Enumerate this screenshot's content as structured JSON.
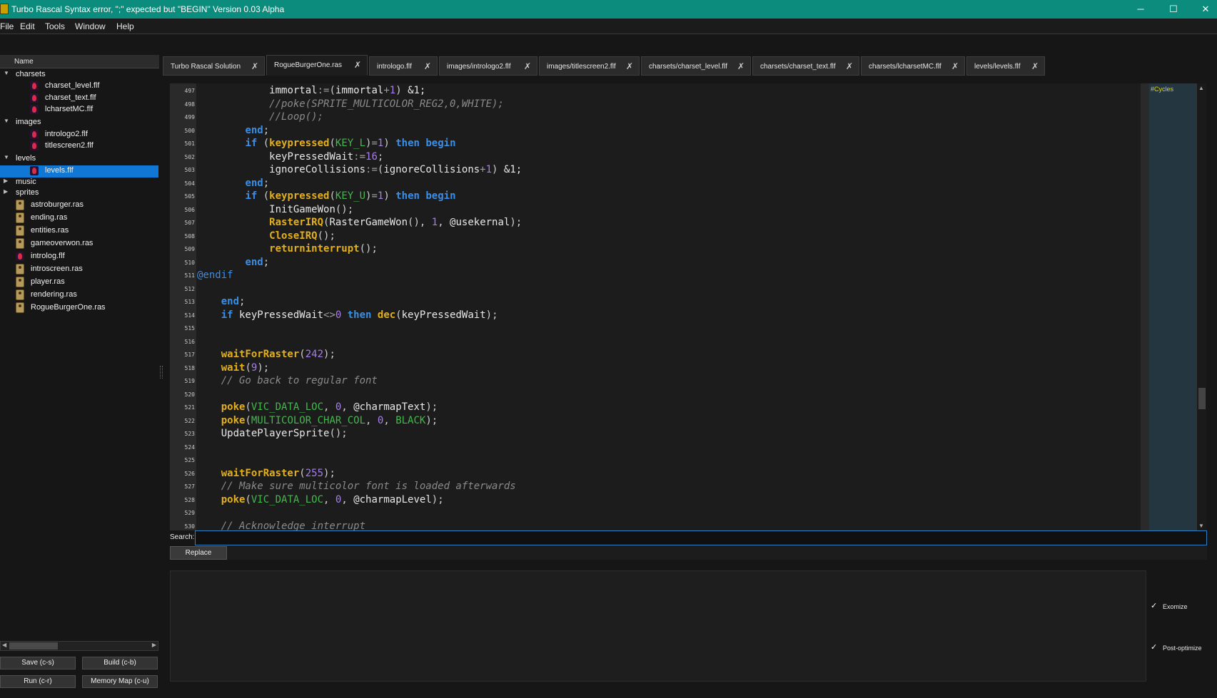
{
  "window": {
    "title": "Turbo Rascal Syntax error, \";\" expected but \"BEGIN\" Version 0.03 Alpha",
    "minimize": "─",
    "maximize": "☐",
    "close": "✕"
  },
  "menu": [
    "File",
    "Edit",
    "Tools",
    "Window",
    "Help"
  ],
  "tree": {
    "header": "Name",
    "nodes": [
      {
        "label": "charsets",
        "kind": "folder",
        "expanded": true
      },
      {
        "label": "charset_level.flf",
        "kind": "flf"
      },
      {
        "label": "charset_text.flf",
        "kind": "flf"
      },
      {
        "label": "lcharsetMC.flf",
        "kind": "flf"
      },
      {
        "label": "images",
        "kind": "folder",
        "expanded": true
      },
      {
        "label": "intrologo2.flf",
        "kind": "flf"
      },
      {
        "label": "titlescreen2.flf",
        "kind": "flf"
      },
      {
        "label": "levels",
        "kind": "folder",
        "expanded": true
      },
      {
        "label": "levels.flf",
        "kind": "flf",
        "selected": true
      },
      {
        "label": "music",
        "kind": "folder",
        "expanded": false
      },
      {
        "label": "sprites",
        "kind": "folder",
        "expanded": false
      },
      {
        "label": "astroburger.ras",
        "kind": "ras"
      },
      {
        "label": "ending.ras",
        "kind": "ras"
      },
      {
        "label": "entities.ras",
        "kind": "ras"
      },
      {
        "label": "gameoverwon.ras",
        "kind": "ras"
      },
      {
        "label": "introlog.flf",
        "kind": "flf"
      },
      {
        "label": "introscreen.ras",
        "kind": "ras"
      },
      {
        "label": "player.ras",
        "kind": "ras"
      },
      {
        "label": "rendering.ras",
        "kind": "ras"
      },
      {
        "label": "RogueBurgerOne.ras",
        "kind": "ras"
      }
    ]
  },
  "buttons": {
    "save": "Save (c-s)",
    "build": "Build (c-b)",
    "run": "Run (c-r)",
    "memory_map": "Memory Map (c-u)",
    "replace": "Replace"
  },
  "tabs": [
    {
      "label": "Turbo Rascal Solution"
    },
    {
      "label": "RogueBurgerOne.ras",
      "active": true
    },
    {
      "label": "intrologo.flf"
    },
    {
      "label": "images/intrologo2.flf"
    },
    {
      "label": "images/titlescreen2.flf"
    },
    {
      "label": "charsets/charset_level.flf"
    },
    {
      "label": "charsets/charset_text.flf"
    },
    {
      "label": "charsets/lcharsetMC.flf"
    },
    {
      "label": "levels/levels.flf"
    }
  ],
  "tab_close_glyph": "✗",
  "code": {
    "first_line": 497,
    "lines": [
      [
        [
          "",
          "            "
        ],
        [
          "var",
          "immortal"
        ],
        [
          "op",
          ":="
        ],
        [
          "pun",
          "("
        ],
        [
          "var",
          "immortal"
        ],
        [
          "op",
          "+"
        ],
        [
          "num",
          "1"
        ],
        [
          "pun",
          ")"
        ],
        [
          "var",
          " &1;"
        ]
      ],
      [
        [
          "cm",
          "            //poke(SPRITE_MULTICOLOR_REG2,0,WHITE);"
        ]
      ],
      [
        [
          "cm",
          "            //Loop();"
        ]
      ],
      [
        [
          "",
          "        "
        ],
        [
          "kw",
          "end"
        ],
        [
          "pun",
          ";"
        ]
      ],
      [
        [
          "",
          "        "
        ],
        [
          "kw",
          "if"
        ],
        [
          "pun",
          " ("
        ],
        [
          "fn",
          "keypressed"
        ],
        [
          "pun",
          "("
        ],
        [
          "con",
          "KEY_L"
        ],
        [
          "pun",
          ")"
        ],
        [
          "op",
          "="
        ],
        [
          "num",
          "1"
        ],
        [
          "pun",
          ") "
        ],
        [
          "kw",
          "then begin"
        ]
      ],
      [
        [
          "",
          "            "
        ],
        [
          "var",
          "keyPressedWait"
        ],
        [
          "op",
          ":="
        ],
        [
          "num",
          "16"
        ],
        [
          "pun",
          ";"
        ]
      ],
      [
        [
          "",
          "            "
        ],
        [
          "var",
          "ignoreCollisions"
        ],
        [
          "op",
          ":="
        ],
        [
          "pun",
          "("
        ],
        [
          "var",
          "ignoreCollisions"
        ],
        [
          "op",
          "+"
        ],
        [
          "num",
          "1"
        ],
        [
          "pun",
          ")"
        ],
        [
          "var",
          " &1;"
        ]
      ],
      [
        [
          "",
          "        "
        ],
        [
          "kw",
          "end"
        ],
        [
          "pun",
          ";"
        ]
      ],
      [
        [
          "",
          "        "
        ],
        [
          "kw",
          "if"
        ],
        [
          "pun",
          " ("
        ],
        [
          "fn",
          "keypressed"
        ],
        [
          "pun",
          "("
        ],
        [
          "con",
          "KEY_U"
        ],
        [
          "pun",
          ")"
        ],
        [
          "op",
          "="
        ],
        [
          "num",
          "1"
        ],
        [
          "pun",
          ") "
        ],
        [
          "kw",
          "then begin"
        ]
      ],
      [
        [
          "",
          "            "
        ],
        [
          "var",
          "InitGameWon"
        ],
        [
          "pun",
          "();"
        ]
      ],
      [
        [
          "",
          "            "
        ],
        [
          "fn",
          "RasterIRQ"
        ],
        [
          "pun",
          "("
        ],
        [
          "var",
          "RasterGameWon"
        ],
        [
          "pun",
          "(), "
        ],
        [
          "num",
          "1"
        ],
        [
          "pun",
          ", "
        ],
        [
          "var",
          "@usekernal"
        ],
        [
          "pun",
          ");"
        ]
      ],
      [
        [
          "",
          "            "
        ],
        [
          "fn",
          "CloseIRQ"
        ],
        [
          "pun",
          "();"
        ]
      ],
      [
        [
          "",
          "            "
        ],
        [
          "fn",
          "returninterrupt"
        ],
        [
          "pun",
          "();"
        ]
      ],
      [
        [
          "",
          "        "
        ],
        [
          "kw",
          "end"
        ],
        [
          "pun",
          ";"
        ]
      ],
      [
        [
          "pre",
          "@endif"
        ]
      ],
      [],
      [
        [
          "",
          "    "
        ],
        [
          "kw",
          "end"
        ],
        [
          "pun",
          ";"
        ]
      ],
      [
        [
          "",
          "    "
        ],
        [
          "kw",
          "if"
        ],
        [
          "var",
          " keyPressedWait"
        ],
        [
          "op",
          "<>"
        ],
        [
          "num",
          "0"
        ],
        [
          "kw",
          " then "
        ],
        [
          "fn",
          "dec"
        ],
        [
          "pun",
          "("
        ],
        [
          "var",
          "keyPressedWait"
        ],
        [
          "pun",
          ");"
        ]
      ],
      [],
      [],
      [
        [
          "",
          "    "
        ],
        [
          "fn",
          "waitForRaster"
        ],
        [
          "pun",
          "("
        ],
        [
          "num",
          "242"
        ],
        [
          "pun",
          ");"
        ]
      ],
      [
        [
          "",
          "    "
        ],
        [
          "fn",
          "wait"
        ],
        [
          "pun",
          "("
        ],
        [
          "num",
          "9"
        ],
        [
          "pun",
          ");"
        ]
      ],
      [
        [
          "cm",
          "    // Go back to regular font"
        ]
      ],
      [],
      [
        [
          "",
          "    "
        ],
        [
          "fn",
          "poke"
        ],
        [
          "pun",
          "("
        ],
        [
          "con",
          "VIC_DATA_LOC"
        ],
        [
          "pun",
          ", "
        ],
        [
          "num",
          "0"
        ],
        [
          "pun",
          ", "
        ],
        [
          "var",
          "@charmapText"
        ],
        [
          "pun",
          ");"
        ]
      ],
      [
        [
          "",
          "    "
        ],
        [
          "fn",
          "poke"
        ],
        [
          "pun",
          "("
        ],
        [
          "con",
          "MULTICOLOR_CHAR_COL"
        ],
        [
          "pun",
          ", "
        ],
        [
          "num",
          "0"
        ],
        [
          "pun",
          ", "
        ],
        [
          "con",
          "BLACK"
        ],
        [
          "pun",
          ");"
        ]
      ],
      [
        [
          "",
          "    "
        ],
        [
          "var",
          "UpdatePlayerSprite"
        ],
        [
          "pun",
          "();"
        ]
      ],
      [],
      [],
      [
        [
          "",
          "    "
        ],
        [
          "fn",
          "waitForRaster"
        ],
        [
          "pun",
          "("
        ],
        [
          "num",
          "255"
        ],
        [
          "pun",
          ");"
        ]
      ],
      [
        [
          "cm",
          "    // Make sure multicolor font is loaded afterwards"
        ]
      ],
      [
        [
          "",
          "    "
        ],
        [
          "fn",
          "poke"
        ],
        [
          "pun",
          "("
        ],
        [
          "con",
          "VIC_DATA_LOC"
        ],
        [
          "pun",
          ", "
        ],
        [
          "num",
          "0"
        ],
        [
          "pun",
          ", "
        ],
        [
          "var",
          "@charmapLevel"
        ],
        [
          "pun",
          ");"
        ]
      ],
      [],
      [
        [
          "cm",
          "    // Acknowledge interrupt"
        ]
      ]
    ]
  },
  "cycles_label": "#Cycles",
  "search": {
    "label": "Search:",
    "value": ""
  },
  "options": {
    "exomize": {
      "label": "Exomize",
      "checked": true
    },
    "post_optimize": {
      "label": "Post-optimize",
      "checked": true
    }
  },
  "colors": {
    "titlebar": "#0b8c7c",
    "selection": "#1177d4",
    "keyword": "#3a8ee6",
    "function": "#e3b01c",
    "number": "#a77ee8",
    "constant": "#44b84e",
    "comment": "#8a8a8a"
  }
}
